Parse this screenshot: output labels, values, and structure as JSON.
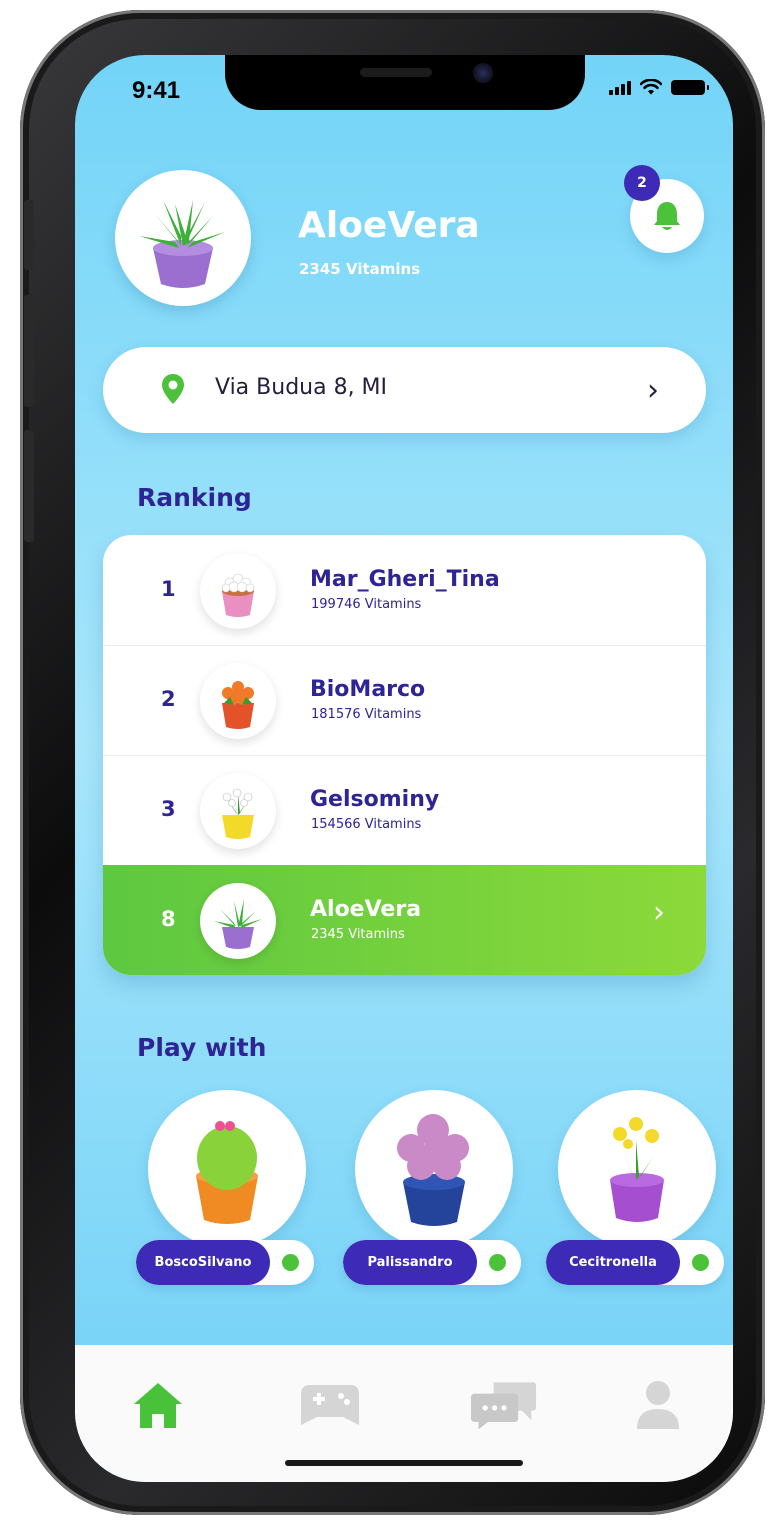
{
  "status_bar": {
    "time": "9:41"
  },
  "profile": {
    "username": "AloeVera",
    "vitamins": "2345 Vitamins",
    "notification_count": "2"
  },
  "location": {
    "address": "Via Budua 8, MI"
  },
  "ranking": {
    "title": "Ranking",
    "rows": [
      {
        "rank": "1",
        "name": "Mar_Gheri_Tina",
        "vitamins": "199746 Vitamins"
      },
      {
        "rank": "2",
        "name": "BioMarco",
        "vitamins": "181576 Vitamins"
      },
      {
        "rank": "3",
        "name": "Gelsominy",
        "vitamins": "154566 Vitamins"
      },
      {
        "rank": "8",
        "name": "AloeVera",
        "vitamins": "2345 Vitamins"
      }
    ]
  },
  "play_with": {
    "title": "Play with",
    "friends": [
      {
        "name": "BoscoSilvano",
        "status": "online"
      },
      {
        "name": "Palissandro",
        "status": "online"
      },
      {
        "name": "Cecitronella",
        "status": "online"
      }
    ]
  },
  "tabbar": {
    "tabs": [
      {
        "icon": "home-icon",
        "active": true
      },
      {
        "icon": "gamepad-icon",
        "active": false
      },
      {
        "icon": "chat-icon",
        "active": false
      },
      {
        "icon": "profile-icon",
        "active": false
      }
    ]
  },
  "colors": {
    "accent_purple": "#2e2496",
    "accent_green": "#5dc840",
    "badge": "#3d2bb8",
    "sky": "#73d4f8"
  }
}
